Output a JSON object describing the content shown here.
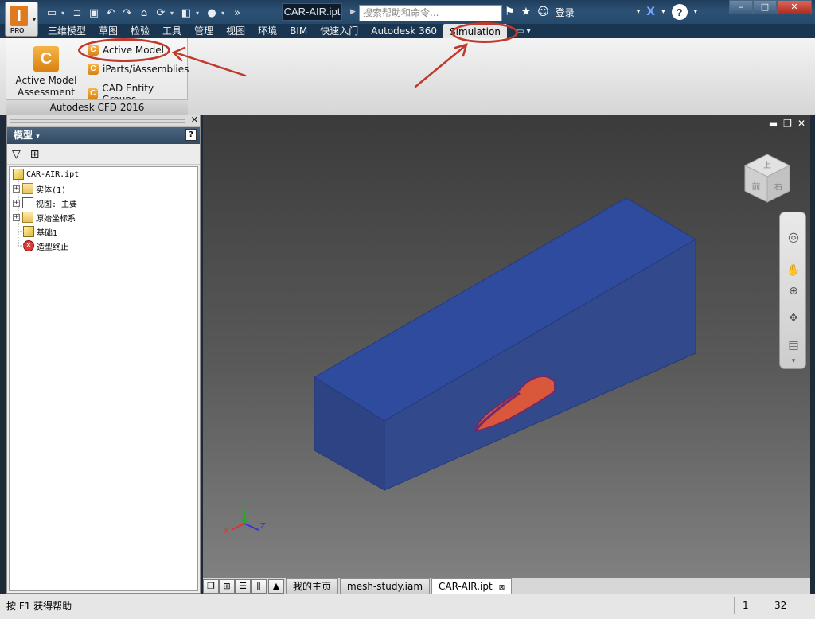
{
  "app": {
    "logo_letter": "I",
    "edition": "PRO"
  },
  "titlebar": {
    "document_title": "CAR-AIR.ipt",
    "search_placeholder": "搜索帮助和命令...",
    "login_label": "登录",
    "help_label": "?"
  },
  "ribbon": {
    "tabs": [
      {
        "label": "三维模型",
        "active": false
      },
      {
        "label": "草图",
        "active": false
      },
      {
        "label": "检验",
        "active": false
      },
      {
        "label": "工具",
        "active": false
      },
      {
        "label": "管理",
        "active": false
      },
      {
        "label": "视图",
        "active": false
      },
      {
        "label": "环境",
        "active": false
      },
      {
        "label": "BIM",
        "active": false
      },
      {
        "label": "快速入门",
        "active": false
      },
      {
        "label": "Autodesk 360",
        "active": false
      },
      {
        "label": "Simulation",
        "active": true
      }
    ],
    "panel": {
      "title": "Autodesk CFD 2016",
      "big_tool": {
        "line1": "Active Model",
        "line2": "Assessment Tool"
      },
      "small_tools": [
        "Active Model",
        "iParts/iAssemblies",
        "CAD Entity Groups"
      ]
    },
    "highlight_color": "#c0392b"
  },
  "browser": {
    "title": "模型",
    "tree": {
      "root": "CAR-AIR.ipt",
      "items": [
        {
          "label": "实体(1)",
          "expandable": true,
          "icon": "solid-bodies-icon"
        },
        {
          "label": "视图: 主要",
          "expandable": true,
          "icon": "view-icon"
        },
        {
          "label": "原始坐标系",
          "expandable": true,
          "icon": "folder-icon"
        },
        {
          "label": "基础1",
          "expandable": false,
          "icon": "extrusion-icon"
        },
        {
          "label": "造型终止",
          "expandable": false,
          "icon": "end-of-part-icon"
        }
      ]
    }
  },
  "viewport": {
    "viewcube_labels": {
      "top": "上",
      "left": "前",
      "right": "右"
    },
    "triad": {
      "x": "X",
      "y": "Y",
      "z": "Z"
    },
    "colors": {
      "box_top": "#2e4a9c",
      "box_front": "#2d4790",
      "box_side": "#344e8f",
      "car_fill": "#d9583b"
    }
  },
  "doc_tabs": [
    {
      "label": "我的主页",
      "active": false
    },
    {
      "label": "mesh-study.iam",
      "active": false
    },
    {
      "label": "CAR-AIR.ipt",
      "active": true
    }
  ],
  "status": {
    "hint": "按 F1 获得帮助",
    "count1": "1",
    "count2": "32"
  }
}
